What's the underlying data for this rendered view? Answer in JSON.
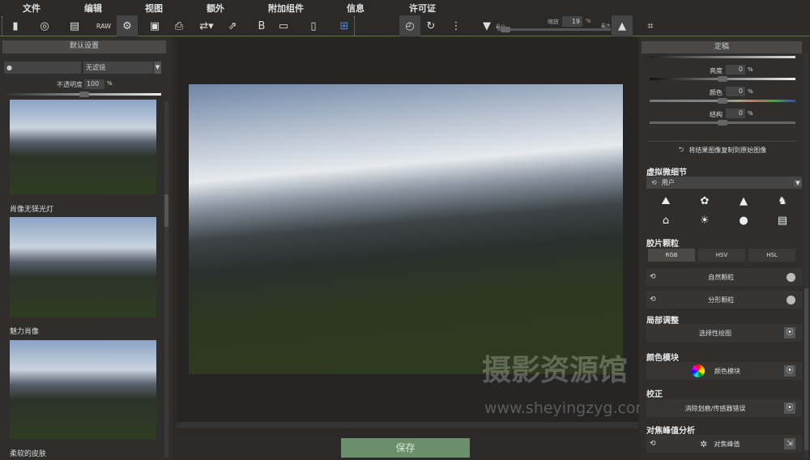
{
  "menu": [
    "文件",
    "编辑",
    "视图",
    "额外",
    "附加组件",
    "信息",
    "许可证"
  ],
  "toolbar": {
    "zoom_label": "缩放",
    "zoom_value": "19",
    "zoom_unit": "%",
    "min_label": "最小",
    "max_label": "最大",
    "zoom_fraction": 0.05
  },
  "left": {
    "preset_button": "默认设置",
    "search_placeholder": "",
    "filter_value": "无滤镜",
    "opacity_label": "不透明度",
    "opacity_value": "100",
    "opacity_unit": "%",
    "opacity_fraction": 1.0,
    "presets": [
      "肖像无镁光灯",
      "魅力肖像",
      "柔软的皮肤"
    ]
  },
  "center": {
    "save_button": "保存"
  },
  "right": {
    "header": "定稿",
    "sliders": [
      {
        "label": "亮度",
        "value": "0",
        "unit": "%"
      },
      {
        "label": "颜色",
        "value": "0",
        "unit": "%"
      },
      {
        "label": "结构",
        "value": "0",
        "unit": "%"
      }
    ],
    "copy_button": "将结果图像复制到原始图像",
    "detail_title": "虚拟微细节",
    "detail_preset": "用户",
    "grain_title": "胶片颗粒",
    "grain_modes": [
      "RGB",
      "HSV",
      "HSL"
    ],
    "grain_rows": [
      "自然颗粒",
      "分形颗粒"
    ],
    "local_title": "局部调整",
    "local_button": "选择性绘图",
    "color_title": "颜色模块",
    "color_button": "颜色模块",
    "correction_title": "校正",
    "correction_button": "消除划痕/传感器错误",
    "focus_title": "对焦峰值分析",
    "focus_button": "对焦峰值"
  },
  "watermark": {
    "name": "摄影资源馆",
    "url": "www.sheyingzyg.com"
  }
}
